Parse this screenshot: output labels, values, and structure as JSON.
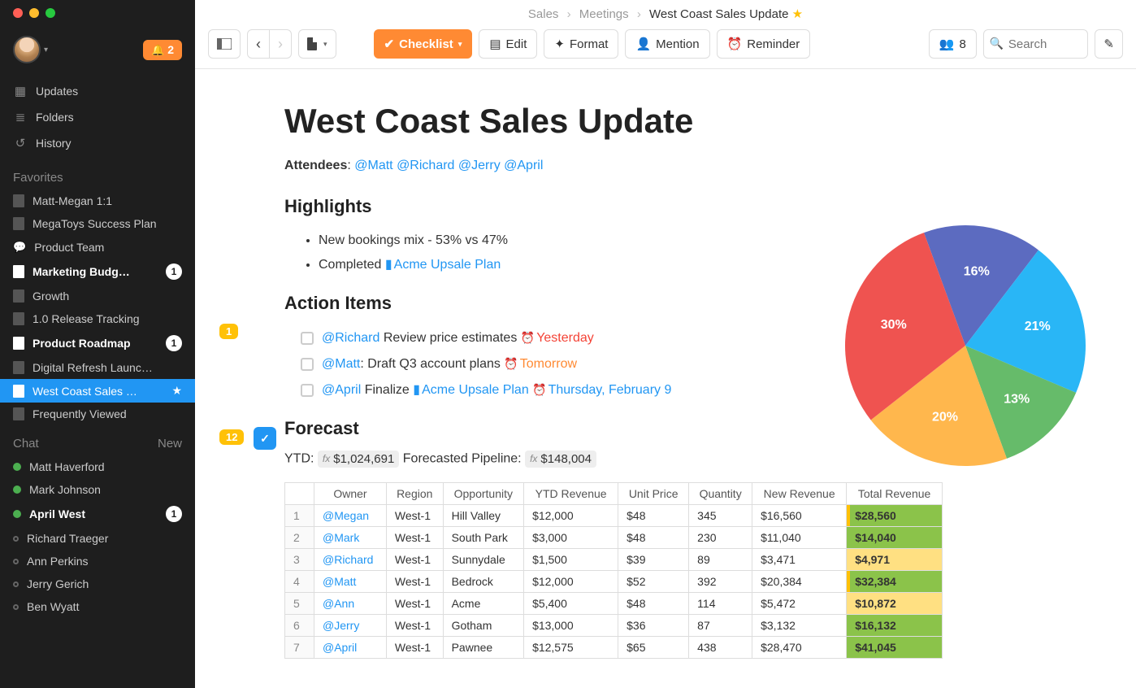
{
  "breadcrumb": {
    "root": "Sales",
    "mid": "Meetings",
    "current": "West Coast Sales Update"
  },
  "notifications": "2",
  "search": {
    "placeholder": "Search"
  },
  "toolbar": {
    "checklist": "Checklist",
    "edit": "Edit",
    "format": "Format",
    "mention": "Mention",
    "reminder": "Reminder",
    "people_count": "8"
  },
  "sidebar": {
    "nav": {
      "updates": "Updates",
      "folders": "Folders",
      "history": "History"
    },
    "favorites_header": "Favorites",
    "favorites": [
      {
        "label": "Matt-Megan 1:1"
      },
      {
        "label": "MegaToys Success Plan"
      },
      {
        "label": "Product Team",
        "icon": "chat"
      },
      {
        "label": "Marketing Budg…",
        "bold": true,
        "count": "1",
        "white": true
      },
      {
        "label": "Growth"
      },
      {
        "label": "1.0 Release Tracking"
      },
      {
        "label": "Product Roadmap",
        "bold": true,
        "count": "1",
        "white": true
      },
      {
        "label": "Digital Refresh Launc…"
      },
      {
        "label": "West Coast Sales …",
        "active": true,
        "star": true
      },
      {
        "label": "Frequently Viewed"
      }
    ],
    "chat_header": "Chat",
    "chat_new": "New",
    "chats": [
      {
        "name": "Matt Haverford",
        "online": true
      },
      {
        "name": "Mark Johnson",
        "online": true
      },
      {
        "name": "April West",
        "online": true,
        "bold": true,
        "count": "1"
      },
      {
        "name": "Richard Traeger",
        "online": false
      },
      {
        "name": "Ann Perkins",
        "online": false
      },
      {
        "name": "Jerry Gerich",
        "online": false
      },
      {
        "name": "Ben Wyatt",
        "online": false
      }
    ]
  },
  "doc": {
    "title": "West Coast Sales Update",
    "attendees_label": "Attendees",
    "attendees": [
      "@Matt",
      "@Richard",
      "@Jerry",
      "@April"
    ],
    "highlights_header": "Highlights",
    "highlights_badge": "1",
    "highlight1": "New bookings mix - 53% vs 47%",
    "highlight2_prefix": "Completed ",
    "highlight2_link": "Acme Upsale Plan",
    "action_header": "Action Items",
    "action_badge": "12",
    "actions": [
      {
        "mention": "@Richard",
        "text": " Review price estimates ",
        "due": "Yesterday",
        "due_class": "due-red"
      },
      {
        "mention": "@Matt",
        "text": ": Draft Q3 account plans ",
        "due": "Tomorrow",
        "due_class": "due-orange"
      },
      {
        "mention": "@April",
        "text": " Finalize ",
        "link": "Acme Upsale Plan",
        "due": "Thursday, February 9",
        "due_class": "due-blue"
      }
    ],
    "forecast_header": "Forecast",
    "ytd_label": "YTD: ",
    "ytd_value": "$1,024,691",
    "pipeline_label": "  Forecasted Pipeline: ",
    "pipeline_value": "$148,004",
    "table_headers": [
      "Owner",
      "Region",
      "Opportunity",
      "YTD Revenue",
      "Unit Price",
      "Quantity",
      "New Revenue",
      "Total Revenue"
    ],
    "table_rows": [
      {
        "n": "1",
        "owner": "@Megan",
        "region": "West-1",
        "opp": "Hill Valley",
        "ytd": "$12,000",
        "price": "$48",
        "qty": "345",
        "newrev": "$16,560",
        "total": "$28,560",
        "total_class": "rev-green rev-marker-g"
      },
      {
        "n": "2",
        "owner": "@Mark",
        "region": "West-1",
        "opp": "South Park",
        "ytd": "$3,000",
        "price": "$48",
        "qty": "230",
        "newrev": "$11,040",
        "total": "$14,040",
        "total_class": "rev-green"
      },
      {
        "n": "3",
        "owner": "@Richard",
        "region": "West-1",
        "opp": "Sunnydale",
        "ytd": "$1,500",
        "price": "$39",
        "qty": "89",
        "newrev": "$3,471",
        "total": "$4,971",
        "total_class": "rev-yellow"
      },
      {
        "n": "4",
        "owner": "@Matt",
        "region": "West-1",
        "opp": "Bedrock",
        "ytd": "$12,000",
        "price": "$52",
        "qty": "392",
        "newrev": "$20,384",
        "total": "$32,384",
        "total_class": "rev-green rev-marker-g"
      },
      {
        "n": "5",
        "owner": "@Ann",
        "region": "West-1",
        "opp": "Acme",
        "ytd": "$5,400",
        "price": "$48",
        "qty": "114",
        "newrev": "$5,472",
        "total": "$10,872",
        "total_class": "rev-yellow"
      },
      {
        "n": "6",
        "owner": "@Jerry",
        "region": "West-1",
        "opp": "Gotham",
        "ytd": "$13,000",
        "price": "$36",
        "qty": "87",
        "newrev": "$3,132",
        "total": "$16,132",
        "total_class": "rev-green"
      },
      {
        "n": "7",
        "owner": "@April",
        "region": "West-1",
        "opp": "Pawnee",
        "ytd": "$12,575",
        "price": "$65",
        "qty": "438",
        "newrev": "$28,470",
        "total": "$41,045",
        "total_class": "rev-green"
      }
    ]
  },
  "chart_data": {
    "type": "pie",
    "values": [
      16,
      21,
      13,
      20,
      30
    ],
    "colors": [
      "#5c6bc0",
      "#29b6f6",
      "#66bb6a",
      "#ffb74d",
      "#ef5350"
    ],
    "labels": [
      "16%",
      "21%",
      "13%",
      "20%",
      "30%"
    ]
  }
}
